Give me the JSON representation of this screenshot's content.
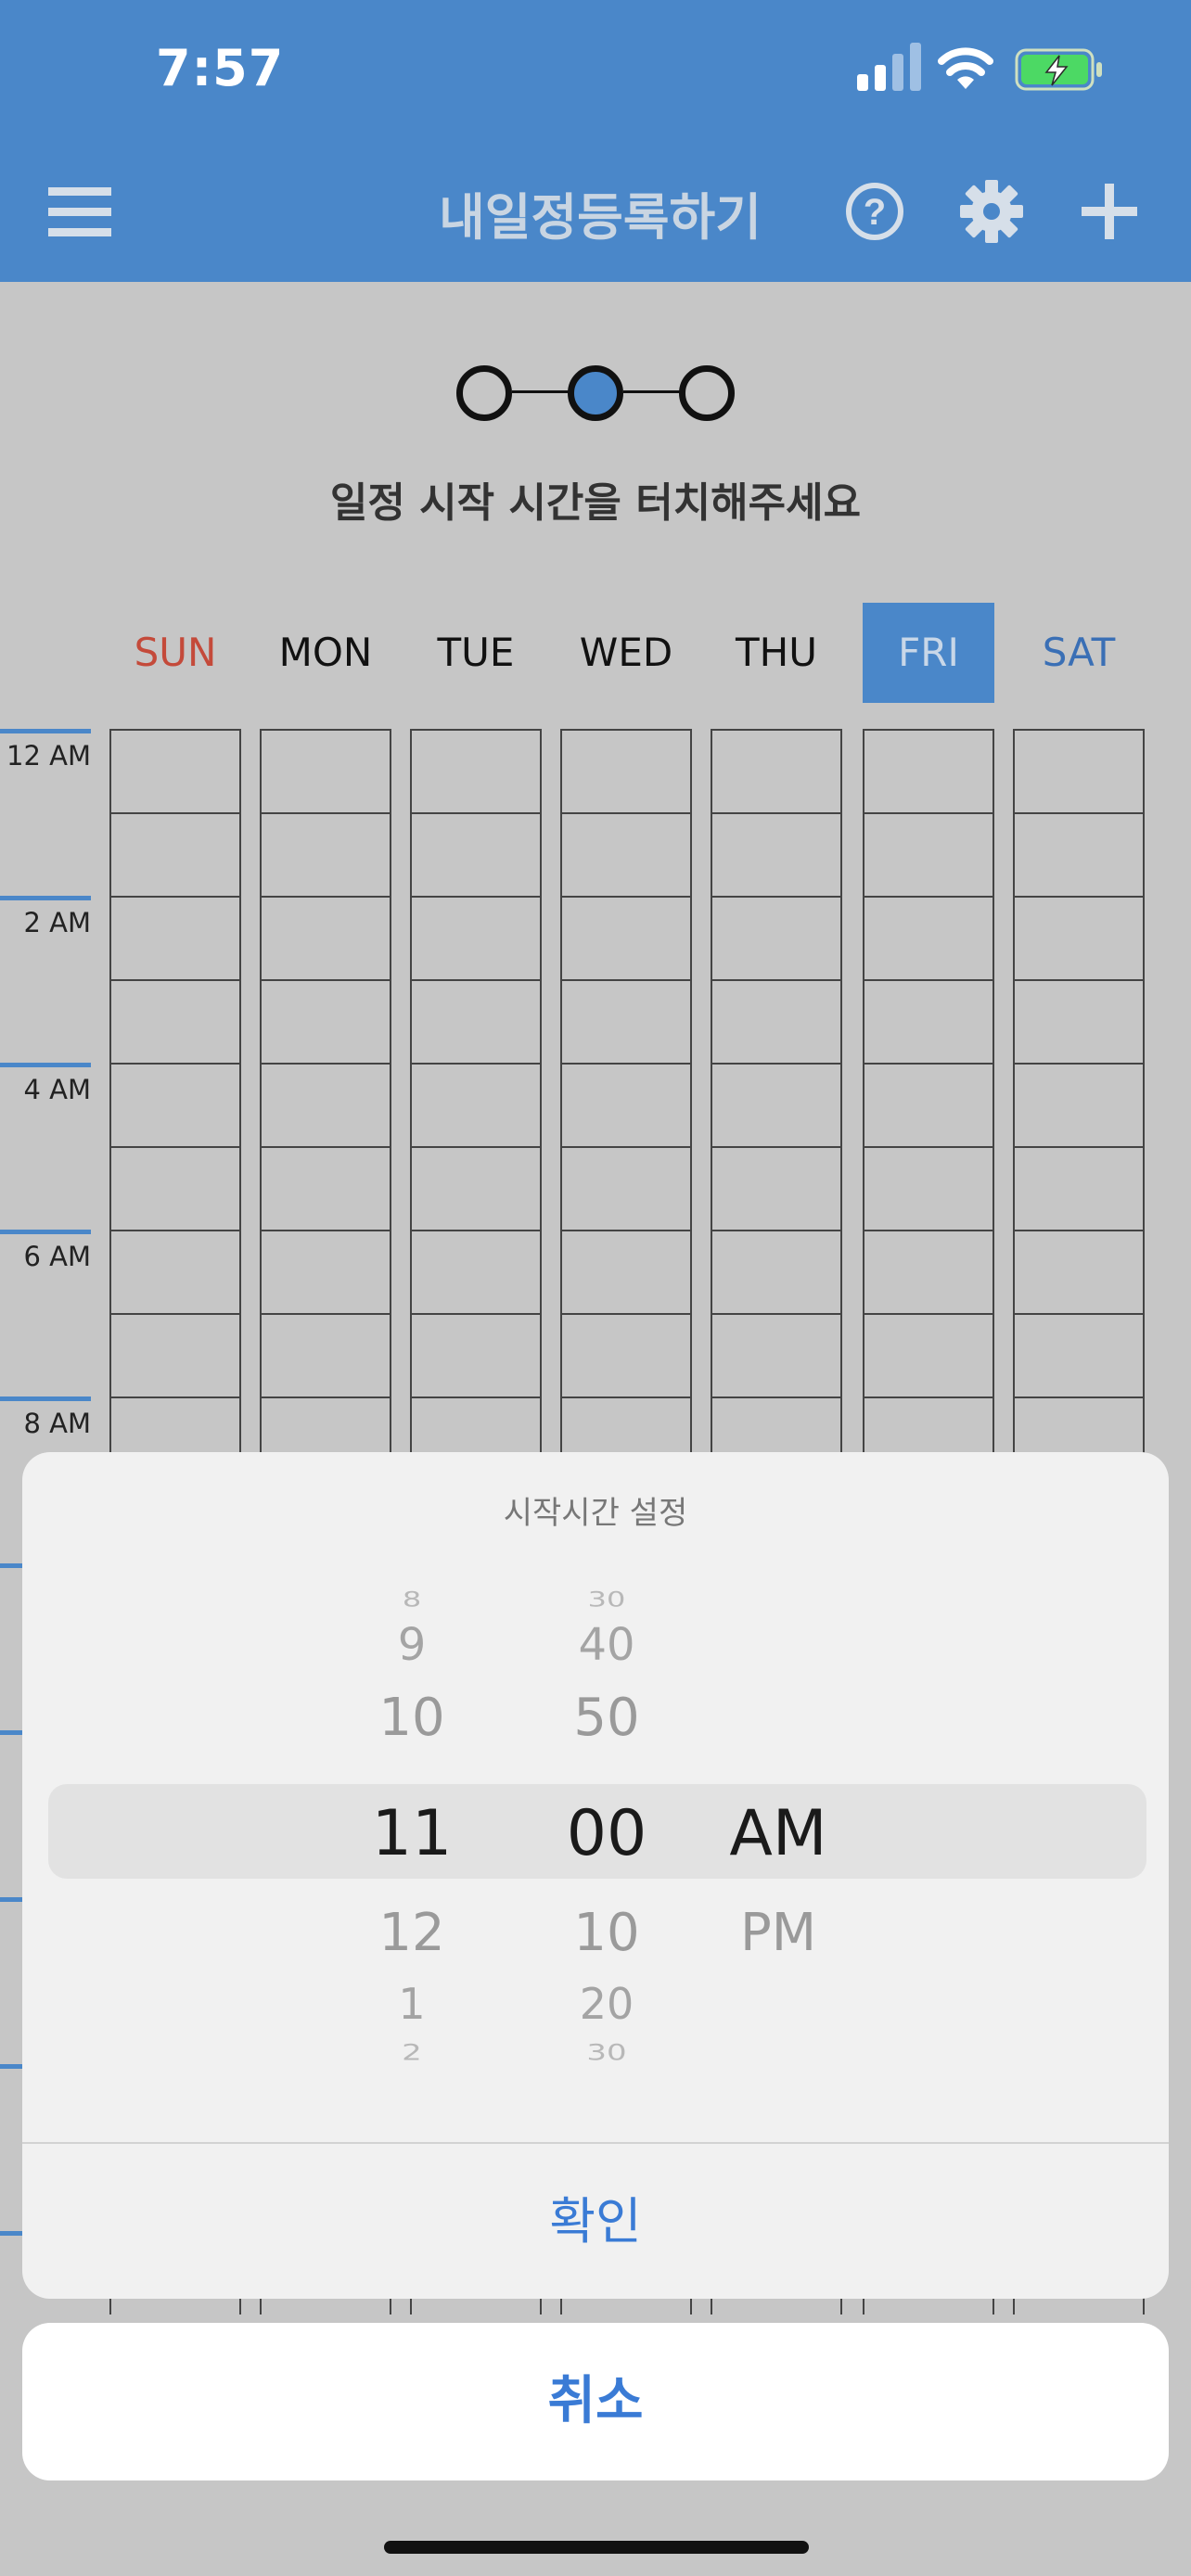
{
  "status_bar": {
    "time": "7:57"
  },
  "header": {
    "title": "내일정등록하기",
    "icons": [
      "menu-icon",
      "help-icon",
      "gear-icon",
      "plus-icon"
    ]
  },
  "steps": {
    "total": 3,
    "active": 2
  },
  "instruction": "일정 시작 시간을 터치해주세요",
  "days": [
    {
      "label": "SUN"
    },
    {
      "label": "MON"
    },
    {
      "label": "TUE"
    },
    {
      "label": "WED"
    },
    {
      "label": "THU"
    },
    {
      "label": "FRI",
      "selected": true
    },
    {
      "label": "SAT"
    }
  ],
  "hours": [
    "12 AM",
    "2 AM",
    "4 AM",
    "6 AM",
    "8 AM"
  ],
  "picker_sheet": {
    "title": "시작시간 설정",
    "hour_options": [
      "8",
      "9",
      "10",
      "11",
      "12",
      "1",
      "2"
    ],
    "minute_options": [
      "30",
      "40",
      "50",
      "00",
      "10",
      "20",
      "30"
    ],
    "period_options": [
      "AM",
      "PM"
    ],
    "selected": {
      "hour": "11",
      "minute": "00",
      "period": "AM"
    },
    "confirm_label": "확인"
  },
  "cancel_label": "취소",
  "colors": {
    "accent": "#4a87c9",
    "sunday": "#c44a3a",
    "saturday": "#3a6fb5",
    "action": "#3a7bd5"
  }
}
